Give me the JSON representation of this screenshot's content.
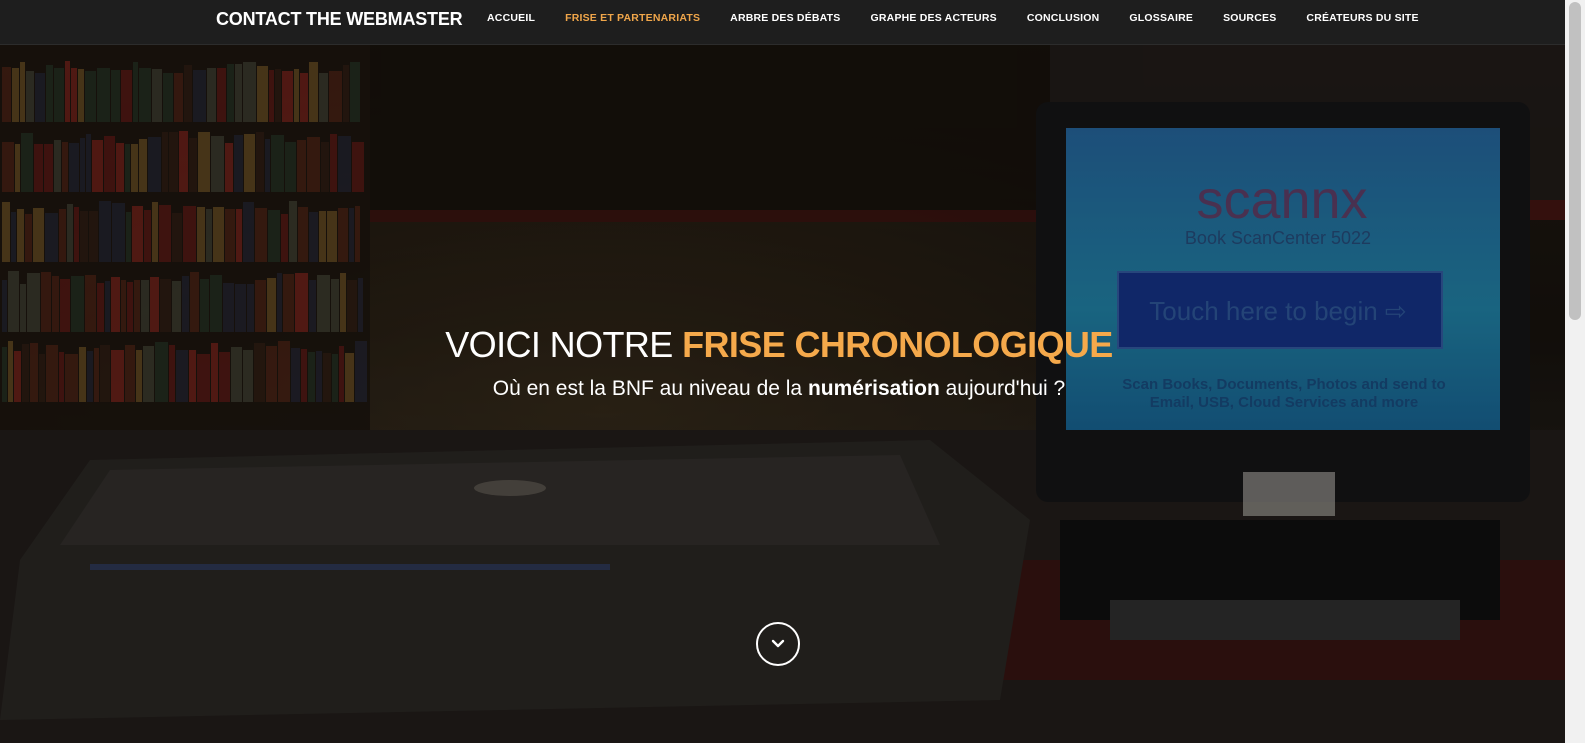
{
  "navbar": {
    "brand": "CONTACT THE WEBMASTER",
    "items": [
      {
        "label": "ACCUEIL",
        "active": false
      },
      {
        "label": "FRISE ET PARTENARIATS",
        "active": true
      },
      {
        "label": "ARBRE DES DÉBATS",
        "active": false
      },
      {
        "label": "GRAPHE DES ACTEURS",
        "active": false
      },
      {
        "label": "CONCLUSION",
        "active": false
      },
      {
        "label": "GLOSSAIRE",
        "active": false
      },
      {
        "label": "SOURCES",
        "active": false
      },
      {
        "label": "CRÉATEURS DU SITE",
        "active": false
      }
    ]
  },
  "hero": {
    "heading_plain": "VOICI NOTRE ",
    "heading_accent": "FRISE CHRONOLOGIQUE",
    "subtitle_before": "Où en est la BNF au niveau de la ",
    "subtitle_bold": "numérisation",
    "subtitle_after": " aujourd'hui ?",
    "scanner_screen": {
      "brand": "scannx",
      "model": "Book ScanCenter 5022",
      "button": "Touch here to begin ⇨",
      "caption_line1": "Scan Books, Documents, Photos and send to",
      "caption_line2": "Email, USB, Cloud Services and more"
    }
  },
  "scroll_icon": "chevron-down-icon",
  "colors": {
    "navbar_bg": "#1e1e1e",
    "accent": "#f5a94b",
    "active_nav": "#f0a64a",
    "text": "#ffffff"
  }
}
